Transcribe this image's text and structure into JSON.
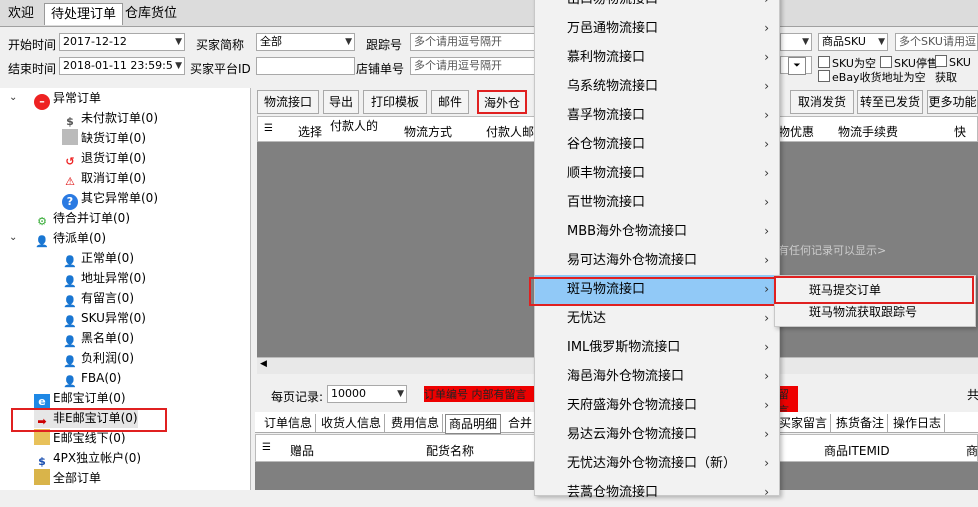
{
  "tabs": [
    "欢迎",
    "待处理订单",
    "仓库货位"
  ],
  "filters": {
    "start_label": "开始时间",
    "start_value": "2017-12-12",
    "end_label": "结束时间",
    "end_value": "2018-01-11 23:59:5",
    "buyer_label": "买家简称",
    "buyer_value": "全部",
    "platform_label": "买家平台ID",
    "platform_value": "",
    "track_label": "跟踪号",
    "track_placeholder": "多个请用逗号隔开",
    "shop_label": "店铺单号",
    "shop_placeholder": "多个请用逗号隔开",
    "sku_select": "商品SKU",
    "sku_placeholder": "多个SKU请用逗",
    "chk1": "SKU为空",
    "chk2": "SKU停售",
    "chk3": "SKU获取",
    "chk4": "eBay收货地址为空"
  },
  "tree": [
    {
      "label": "异常订单",
      "icon": "no-entry-icon"
    },
    {
      "label": "未付款订单(0)",
      "icon": "dollar-icon"
    },
    {
      "label": "缺货订单(0)",
      "icon": "box-icon"
    },
    {
      "label": "退货订单(0)",
      "icon": "return-icon"
    },
    {
      "label": "取消订单(0)",
      "icon": "warning-icon"
    },
    {
      "label": "其它异常单(0)",
      "icon": "question-icon"
    },
    {
      "label": "待合并订单(0)",
      "icon": "gear-icon"
    },
    {
      "label": "待派单(0)",
      "icon": "user-icon"
    },
    {
      "label": "正常单(0)",
      "icon": "user-icon"
    },
    {
      "label": "地址异常(0)",
      "icon": "user-icon"
    },
    {
      "label": "有留言(0)",
      "icon": "user-icon"
    },
    {
      "label": "SKU异常(0)",
      "icon": "user-icon"
    },
    {
      "label": "黑名单(0)",
      "icon": "user-icon"
    },
    {
      "label": "负利润(0)",
      "icon": "user-icon"
    },
    {
      "label": "FBA(0)",
      "icon": "user-icon"
    },
    {
      "label": "E邮宝订单(0)",
      "icon": "ie-icon"
    },
    {
      "label": "非E邮宝订单(0)",
      "icon": "arrow-icon"
    },
    {
      "label": "E邮宝线下(0)",
      "icon": "folder-icon"
    },
    {
      "label": "4PX独立帐户(0)",
      "icon": "dollar-icon"
    },
    {
      "label": "全部订单",
      "icon": "box-icon"
    }
  ],
  "toolbar": [
    "物流接口",
    "导出",
    "打印模板",
    "邮件",
    "海外仓",
    "取消发货",
    "转至已发货",
    "更多功能"
  ],
  "grid_columns": [
    "选择",
    "付款人的",
    "物流方式",
    "付款人邮",
    "物优惠",
    "物流手续费",
    "快递"
  ],
  "empty_hint": "有任何记录可以显示>",
  "pager": {
    "label": "每页记录:",
    "value": "10000",
    "red_text": "订单编号 内部有留言",
    "red_text2": "留言",
    "right": "共"
  },
  "subtabs": [
    "订单信息",
    "收货人信息",
    "费用信息",
    "商品明细",
    "合并",
    "买家留言",
    "拣货备注",
    "操作日志"
  ],
  "detail_columns": [
    "赠品",
    "配货名称",
    "商品ITEMID",
    "商"
  ],
  "menu_items": [
    {
      "label": "出口易物流接口",
      "arrow": "›"
    },
    {
      "label": "万邑通物流接口",
      "arrow": "›"
    },
    {
      "label": "慕利物流接口",
      "arrow": "›"
    },
    {
      "label": "乌系统物流接口",
      "arrow": "›"
    },
    {
      "label": "喜孚物流接口",
      "arrow": "›"
    },
    {
      "label": "谷仓物流接口",
      "arrow": "›"
    },
    {
      "label": "顺丰物流接口",
      "arrow": "›"
    },
    {
      "label": "百世物流接口",
      "arrow": "›"
    },
    {
      "label": "MBB海外仓物流接口",
      "arrow": "›"
    },
    {
      "label": "易可达海外仓物流接口",
      "arrow": "›"
    },
    {
      "label": "斑马物流接口",
      "arrow": "›"
    },
    {
      "label": "无忧达",
      "arrow": "›"
    },
    {
      "label": "IML俄罗斯物流接口",
      "arrow": "›"
    },
    {
      "label": "海邑海外仓物流接口",
      "arrow": "›"
    },
    {
      "label": "天府盛海外仓物流接口",
      "arrow": "›"
    },
    {
      "label": "易达云海外仓物流接口",
      "arrow": "›"
    },
    {
      "label": "无忧达海外仓物流接口（新）",
      "arrow": "›"
    },
    {
      "label": "芸蒿仓物流接口",
      "arrow": "›"
    }
  ],
  "submenu": [
    "斑马提交订单",
    "斑马物流获取跟踪号"
  ]
}
